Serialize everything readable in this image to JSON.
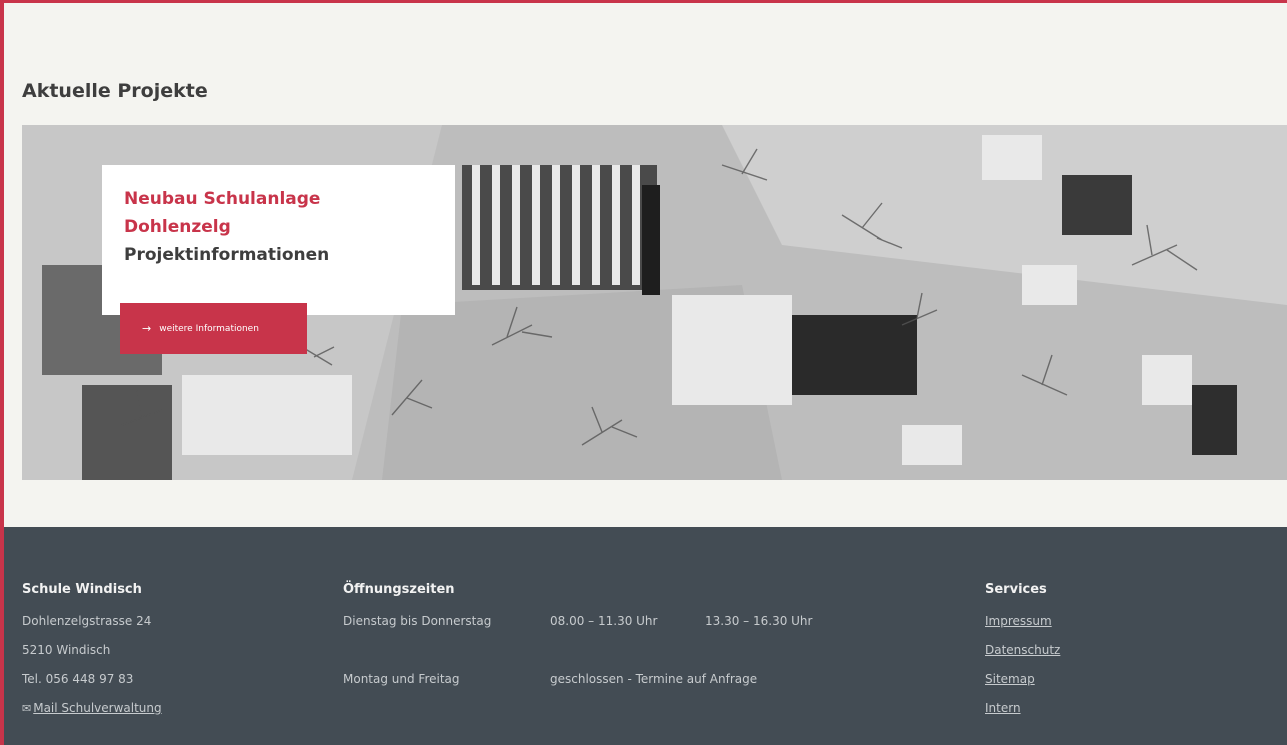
{
  "section": {
    "title": "Aktuelle Projekte"
  },
  "hero": {
    "card_title": "Neubau Schulanlage Dohlenzelg",
    "card_subtitle": "Projektinformationen",
    "cta_icon": "arrow-right-icon",
    "cta_label": "weitere Informationen"
  },
  "footer": {
    "school": {
      "heading": "Schule Windisch",
      "street": "Dohlenzelgstrasse 24",
      "city": "5210 Windisch",
      "phone": "Tel. 056 448 97 83",
      "mail_icon": "mail-icon",
      "mail_label": "Mail Schulverwaltung"
    },
    "hours": {
      "heading": "Öffnungszeiten",
      "rows": [
        {
          "day": "Dienstag bis Donnerstag",
          "time1": "08.00 – 11.30 Uhr",
          "time2": "13.30 – 16.30 Uhr"
        },
        {
          "day": "Montag und Freitag",
          "time1": "geschlossen - Termine auf Anfrage",
          "time2": ""
        }
      ]
    },
    "services": {
      "heading": "Services",
      "links": [
        "Impressum",
        "Datenschutz",
        "Sitemap",
        "Intern"
      ]
    }
  },
  "colors": {
    "accent": "#c8344a",
    "footer_bg": "#434c54",
    "page_bg": "#f4f4f0"
  }
}
